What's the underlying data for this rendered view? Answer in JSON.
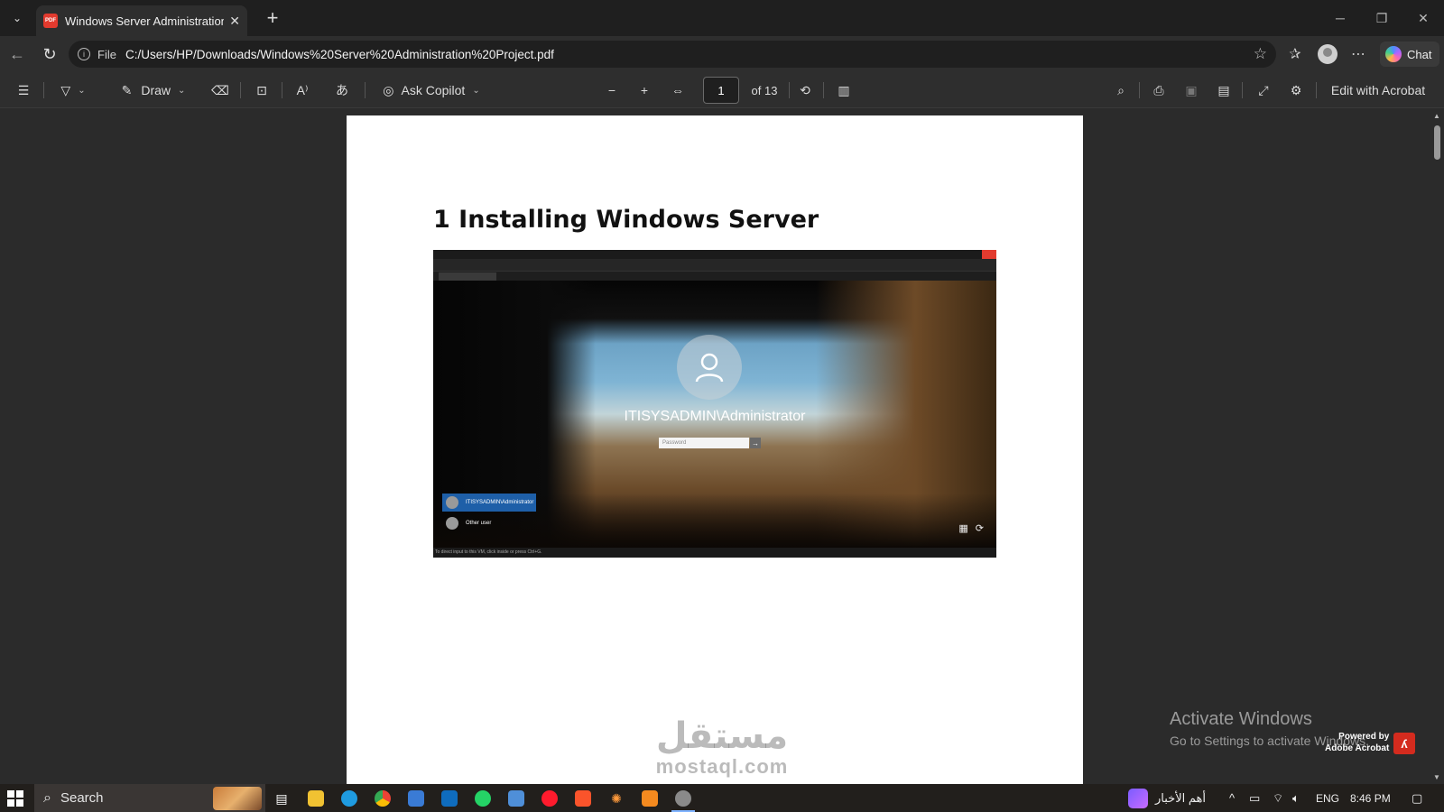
{
  "browser": {
    "tab_title": "Windows Server Administration Project.pdf",
    "file_label": "File",
    "url": "C:/Users/HP/Downloads/Windows%20Server%20Administration%20Project.pdf",
    "chat_label": "Chat"
  },
  "pdf_toolbar": {
    "draw_label": "Draw",
    "ask_copilot_label": "Ask Copilot",
    "page_current": "1",
    "page_total": "of 13",
    "edit_acrobat_label": "Edit with Acrobat"
  },
  "document": {
    "heading": "1 Installing Windows Server",
    "screenshot": {
      "user_name": "ITISYSADMIN\\Administrator",
      "password_placeholder": "Password",
      "account_selected": "ITISYSADMIN\\Administrator",
      "account_other": "Other user",
      "status_text": "To direct input to this VM, click inside or press Ctrl+G."
    }
  },
  "overlay": {
    "activate_title": "Activate Windows",
    "activate_sub": "Go to Settings to activate Windows.",
    "powered_by": "Powered by",
    "adobe_acrobat": "Adobe Acrobat",
    "watermark_ar": "مستقل",
    "watermark_en": "mostaql.com"
  },
  "taskbar": {
    "search_label": "Search",
    "news_label": "أهم الأخبار",
    "language": "ENG",
    "time": "8:46 PM"
  }
}
